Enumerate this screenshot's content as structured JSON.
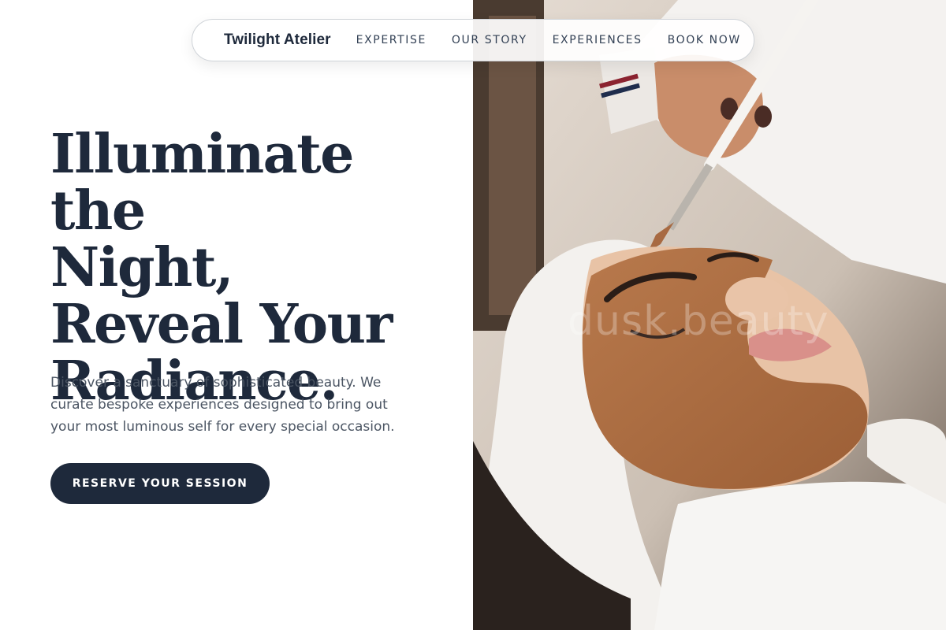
{
  "nav": {
    "brand": "Twilight Atelier",
    "links": [
      "EXPERTISE",
      "OUR STORY",
      "EXPERIENCES",
      "BOOK NOW"
    ]
  },
  "hero": {
    "headline_lines": [
      "Illuminate the",
      "Night,",
      "Reveal Your",
      "Radiance."
    ],
    "lede": "Discover a sanctuary of sophisticated beauty. We curate bespoke experiences designed to bring out your most luminous self for every special occasion.",
    "cta_label": "RESERVE YOUR SESSION",
    "image_watermark": "dusk.beauty"
  },
  "colors": {
    "primary": "#1e293b",
    "body_text": "#4b5563",
    "background": "#ffffff"
  }
}
